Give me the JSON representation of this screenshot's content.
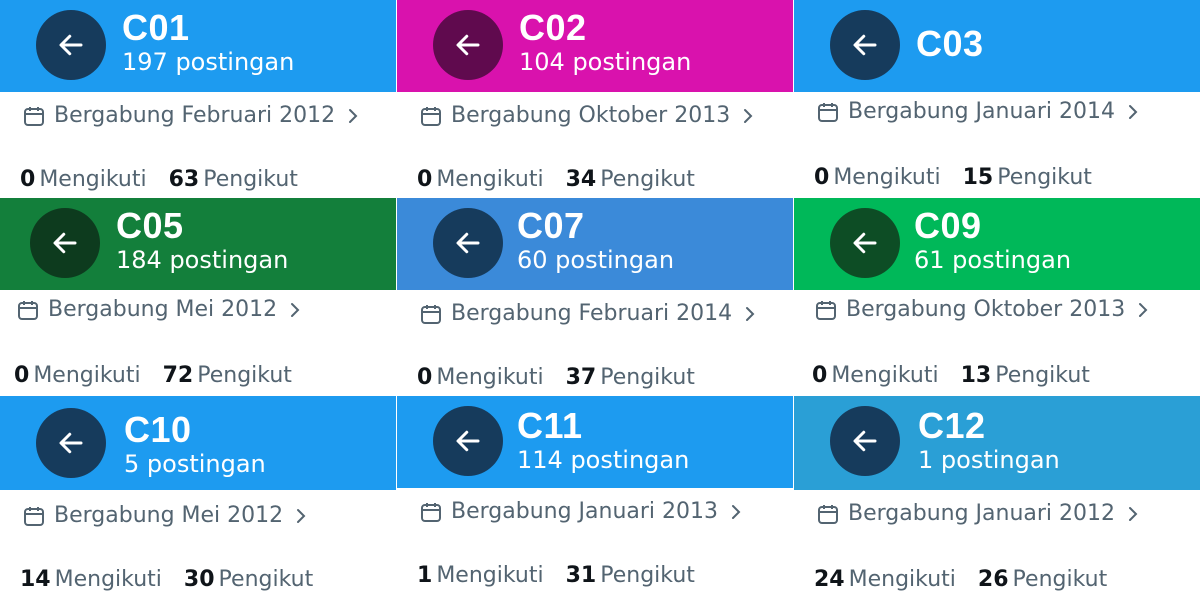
{
  "profiles": [
    {
      "name": "C01",
      "posts": "197 postingan",
      "joined": "Bergabung Februari 2012",
      "following": "0",
      "following_label": "Mengikuti",
      "followers": "63",
      "followers_label": "Pengikut",
      "header_color": "#1d9bf0",
      "button_color": "#163b5c"
    },
    {
      "name": "C02",
      "posts": "104 postingan",
      "joined": "Bergabung Oktober 2013",
      "following": "0",
      "following_label": "Mengikuti",
      "followers": "34",
      "followers_label": "Pengikut",
      "header_color": "#d912ad",
      "button_color": "#600a4e"
    },
    {
      "name": "C03",
      "posts": "",
      "joined": "Bergabung Januari 2014",
      "following": "0",
      "following_label": "Mengikuti",
      "followers": "15",
      "followers_label": "Pengikut",
      "header_color": "#1d9bf0",
      "button_color": "#163b5c"
    },
    {
      "name": "C05",
      "posts": "184 postingan",
      "joined": "Bergabung Mei 2012",
      "following": "0",
      "following_label": "Mengikuti",
      "followers": "72",
      "followers_label": "Pengikut",
      "header_color": "#137f3b",
      "button_color": "#0d3b1e"
    },
    {
      "name": "C07",
      "posts": "60 postingan",
      "joined": "Bergabung Februari 2014",
      "following": "0",
      "following_label": "Mengikuti",
      "followers": "37",
      "followers_label": "Pengikut",
      "header_color": "#3b8ad9",
      "button_color": "#163b5c"
    },
    {
      "name": "C09",
      "posts": "61 postingan",
      "joined": "Bergabung Oktober 2013",
      "following": "0",
      "following_label": "Mengikuti",
      "followers": "13",
      "followers_label": "Pengikut",
      "header_color": "#00b859",
      "button_color": "#0d4d25"
    },
    {
      "name": "C10",
      "posts": "5 postingan",
      "joined": "Bergabung Mei 2012",
      "following": "14",
      "following_label": "Mengikuti",
      "followers": "30",
      "followers_label": "Pengikut",
      "header_color": "#1d9bf0",
      "button_color": "#163b5c"
    },
    {
      "name": "C11",
      "posts": "114 postingan",
      "joined": "Bergabung Januari 2013",
      "following": "1",
      "following_label": "Mengikuti",
      "followers": "31",
      "followers_label": "Pengikut",
      "header_color": "#1d9bf0",
      "button_color": "#163b5c"
    },
    {
      "name": "C12",
      "posts": "1 postingan",
      "joined": "Bergabung Januari 2012",
      "following": "24",
      "following_label": "Mengikuti",
      "followers": "26",
      "followers_label": "Pengikut",
      "header_color": "#2a9fd6",
      "button_color": "#163b5c"
    }
  ],
  "icons": {
    "back": "arrow-left-icon",
    "calendar": "calendar-icon",
    "chevron": "chevron-right-icon"
  }
}
